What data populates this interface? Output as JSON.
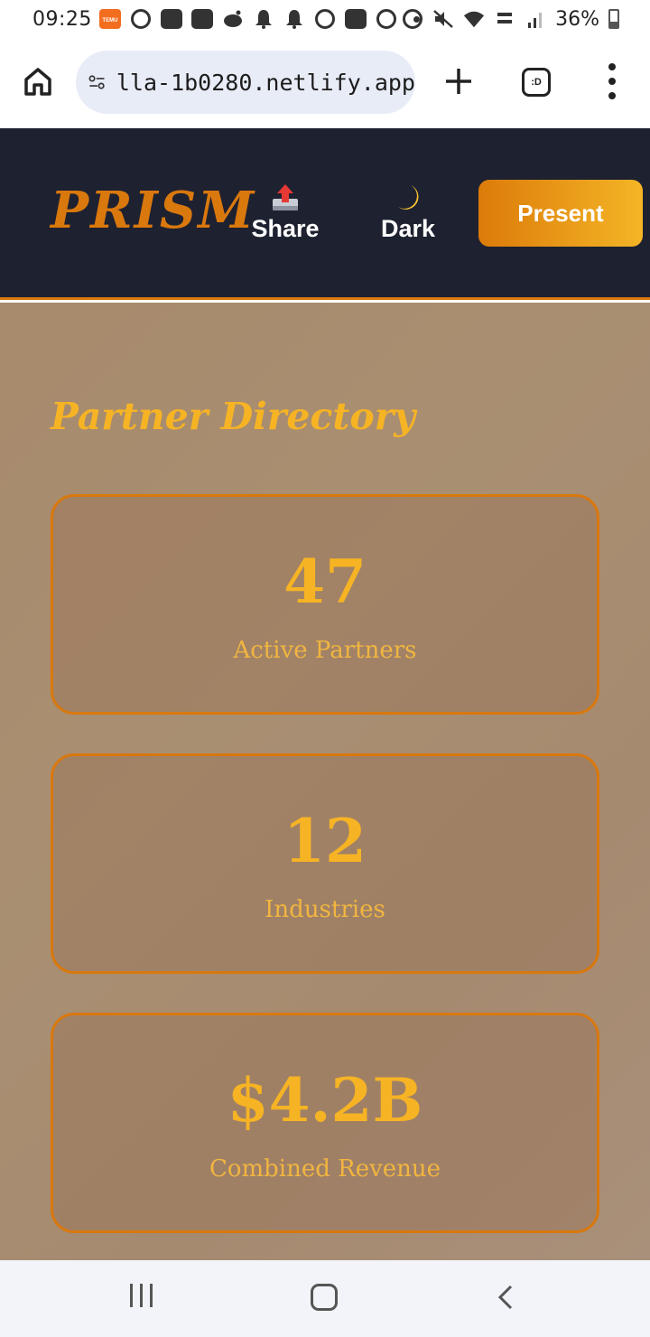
{
  "status_bar": {
    "time": "09:25",
    "temu_label": "TEMU",
    "battery": "36%"
  },
  "browser": {
    "url": "lla-1b0280.netlify.app",
    "tab_count": ":D"
  },
  "header": {
    "logo": "PRISM",
    "share_label": "Share",
    "share_icon": "📤",
    "dark_label": "Dark",
    "dark_icon": "🌙",
    "present_label": "Present"
  },
  "main": {
    "title": "Partner Directory",
    "stats": [
      {
        "value": "47",
        "label": "Active Partners"
      },
      {
        "value": "12",
        "label": "Industries"
      },
      {
        "value": "$4.2B",
        "label": "Combined Revenue"
      }
    ]
  },
  "colors": {
    "accent": "#d9780d",
    "gold": "#f6b324",
    "header_bg": "#1e2130",
    "content_bg": "#a88a6c"
  }
}
